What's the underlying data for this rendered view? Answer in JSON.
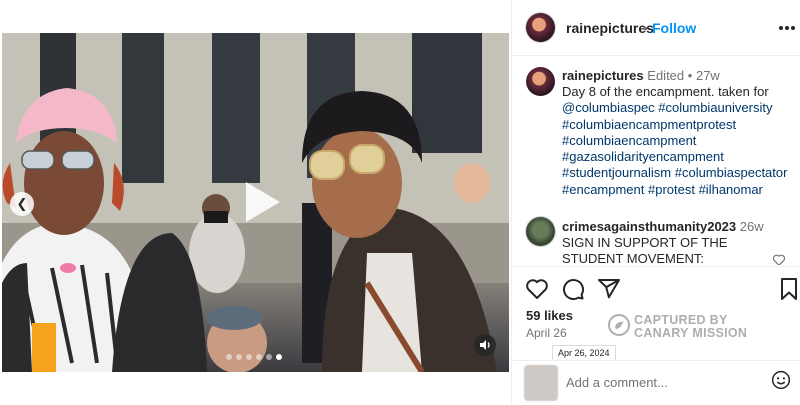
{
  "post": {
    "username": "rainepictures",
    "follow_label": "Follow",
    "separator": "•",
    "caption": {
      "edited": "Edited",
      "time": "27w",
      "lines": [
        "Day 8 of the encampment. taken for",
        "@columbiaspec #columbiauniversity",
        "#columbiaencampmentprotest",
        "#columbiaencampment",
        "#gazasolidarityencampment",
        "#studentjournalism #columbiaspectator",
        "#encampment #protest #ilhanomar"
      ]
    },
    "comment": {
      "username": "crimesagainsthumanity2023",
      "time": "26w",
      "text": "SIGN IN SUPPORT OF THE STUDENT MOVEMENT:"
    },
    "likes": "59 likes",
    "date": "April 26",
    "date_tooltip": "Apr 26, 2024",
    "add_comment_placeholder": "Add a comment..."
  },
  "watermark": {
    "line1": "CAPTURED BY",
    "line2": "CANARY MISSION"
  },
  "media": {
    "carousel_dots": 6,
    "active_dot": 5
  },
  "icons": {
    "more": "more-horizontal-icon",
    "like": "heart-icon",
    "comment": "comment-icon",
    "share": "share-icon",
    "save": "bookmark-icon",
    "emoji": "emoji-icon",
    "play": "play-icon",
    "sound": "speaker-icon",
    "prev": "chevron-left-icon"
  },
  "colors": {
    "link": "#0095f6",
    "hashtag": "#00376b",
    "muted": "#737373",
    "text": "#262626"
  }
}
